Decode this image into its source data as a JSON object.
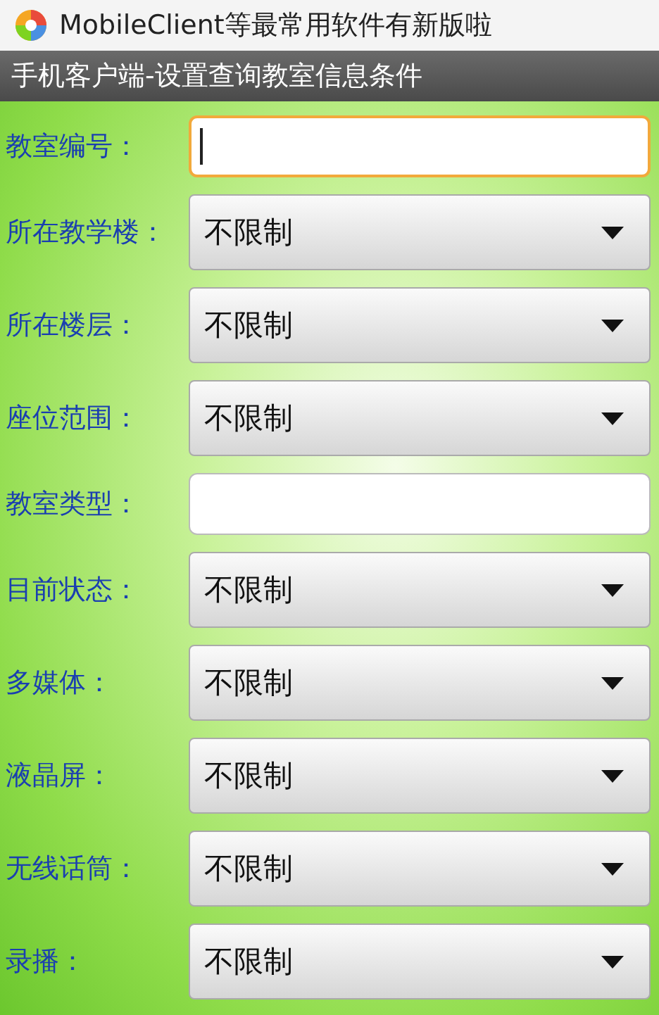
{
  "notification": {
    "text": "MobileClient等最常用软件有新版啦"
  },
  "title_bar": {
    "title": "手机客户端-设置查询教室信息条件"
  },
  "fields": [
    {
      "kind": "text",
      "label": "教室编号：",
      "focused": true
    },
    {
      "kind": "spinner",
      "label": "所在教学楼：",
      "value": "不限制"
    },
    {
      "kind": "spinner",
      "label": "所在楼层：",
      "value": "不限制"
    },
    {
      "kind": "spinner",
      "label": "座位范围：",
      "value": "不限制"
    },
    {
      "kind": "text",
      "label": "教室类型：",
      "focused": false
    },
    {
      "kind": "spinner",
      "label": "目前状态：",
      "value": "不限制"
    },
    {
      "kind": "spinner",
      "label": "多媒体：",
      "value": "不限制"
    },
    {
      "kind": "spinner",
      "label": "液晶屏：",
      "value": "不限制"
    },
    {
      "kind": "spinner",
      "label": "无线话筒：",
      "value": "不限制"
    },
    {
      "kind": "spinner",
      "label": "录播：",
      "value": "不限制"
    }
  ]
}
